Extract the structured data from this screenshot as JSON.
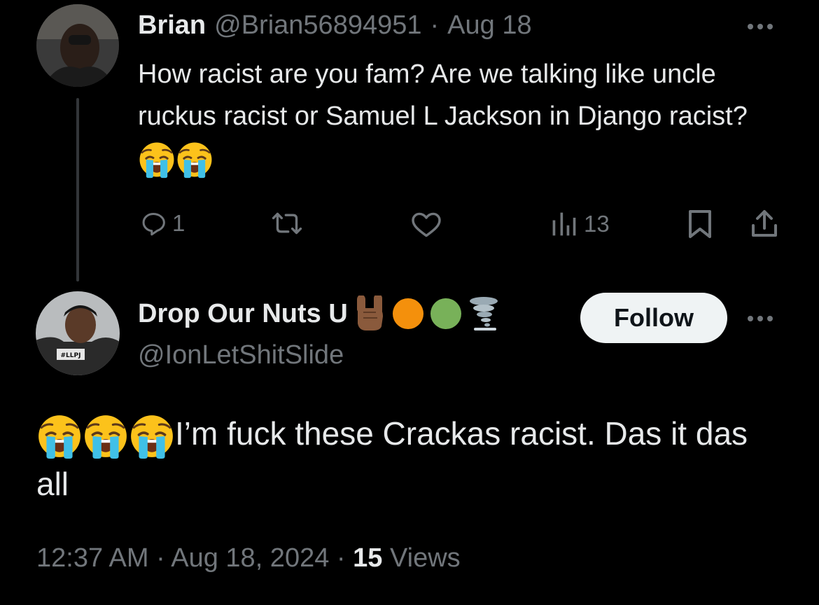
{
  "reply_to": {
    "display_name": "Brian",
    "handle": "@Brian56894951",
    "separator": "·",
    "date": "Aug 18",
    "text": "How racist are you fam? Are we talking like uncle ruckus racist or Samuel L Jackson in Django racist?",
    "emoji": [
      "loudly-crying-face",
      "loudly-crying-face"
    ],
    "actions": {
      "reply_count": "1",
      "retweet_count": "",
      "like_count": "",
      "views_count": "13"
    }
  },
  "main": {
    "display_name": "Drop Our Nuts U",
    "name_emoji": [
      "sign-of-horns-medium-dark",
      "orange-circle",
      "green-circle",
      "tornado"
    ],
    "handle": "@IonLetShitSlide",
    "follow_label": "Follow",
    "text_emoji": [
      "loudly-crying-face",
      "loudly-crying-face",
      "loudly-crying-face"
    ],
    "text": "I’m fuck these Crackas racist. Das it das all",
    "time": "12:37 AM",
    "date": "Aug 18, 2024",
    "views_count": "15",
    "views_label": "Views"
  },
  "colors": {
    "background": "#000000",
    "text": "#e7e9ea",
    "muted": "#71767b",
    "follow_bg": "#eff3f4"
  }
}
